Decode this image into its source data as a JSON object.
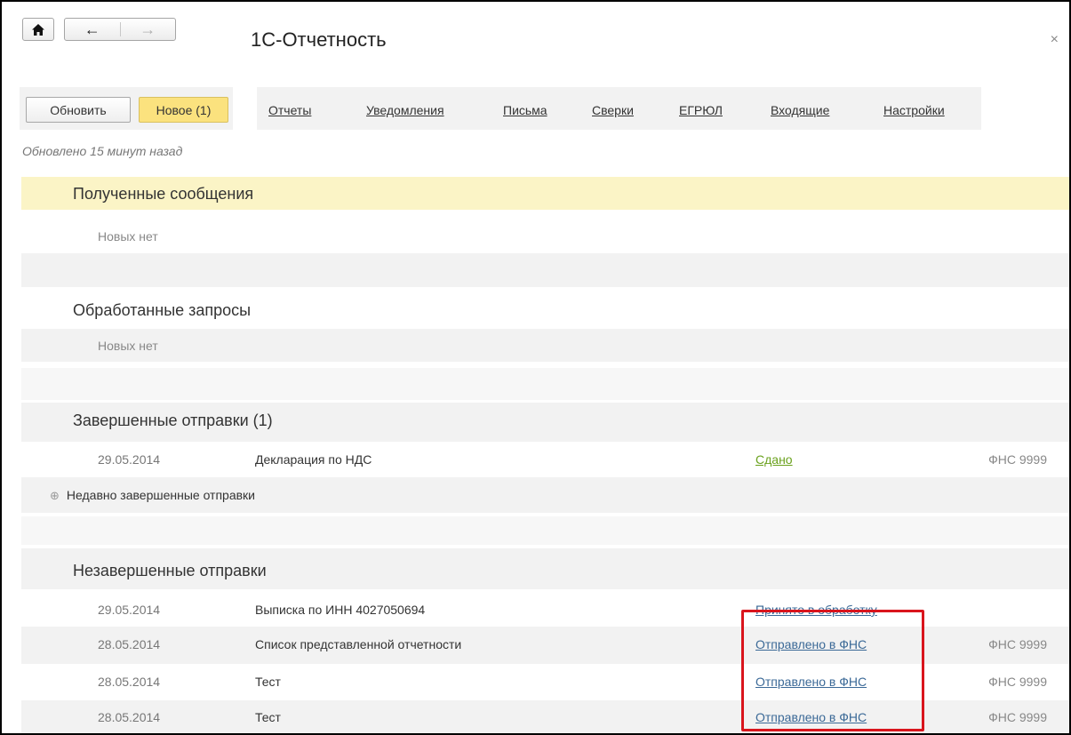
{
  "window": {
    "title": "1С-Отчетность",
    "close_glyph": "×",
    "icons": {
      "home": "home-icon",
      "back": "arrow-left-icon",
      "forward": "arrow-right-icon",
      "close": "close-icon"
    }
  },
  "toolbar": {
    "refresh_label": "Обновить",
    "new_label": "Новое (1)",
    "links": [
      "Отчеты",
      "Уведомления",
      "Письма",
      "Сверки",
      "ЕГРЮЛ",
      "Входящие",
      "Настройки"
    ],
    "updated_text": "Обновлено 15 минут назад"
  },
  "sections": {
    "received": {
      "title": "Полученные сообщения",
      "empty_text": "Новых нет"
    },
    "processed": {
      "title": "Обработанные запросы",
      "empty_text": "Новых нет"
    },
    "completed": {
      "title": "Завершенные отправки (1)",
      "rows": [
        {
          "date": "29.05.2014",
          "name": "Декларация по НДС",
          "status": "Сдано",
          "agency": "ФНС 9999"
        }
      ],
      "recent_expander": "Недавно завершенные отправки"
    },
    "incomplete": {
      "title": "Незавершенные отправки",
      "rows": [
        {
          "date": "29.05.2014",
          "name": "Выписка по ИНН 4027050694",
          "status": "Принято в обработку",
          "agency": ""
        },
        {
          "date": "28.05.2014",
          "name": "Список представленной отчетности",
          "status": "Отправлено в ФНС",
          "agency": "ФНС 9999"
        },
        {
          "date": "28.05.2014",
          "name": "Тест",
          "status": "Отправлено в ФНС",
          "agency": "ФНС 9999"
        },
        {
          "date": "28.05.2014",
          "name": "Тест",
          "status": "Отправлено в ФНС",
          "agency": "ФНС 9999"
        }
      ]
    }
  },
  "colors": {
    "accent_yellow": "#fbe27e",
    "section_highlight": "#fbf4c6",
    "status_done": "#6aa11d",
    "status_link": "#3b6997",
    "annotation_red": "#d9151d"
  }
}
